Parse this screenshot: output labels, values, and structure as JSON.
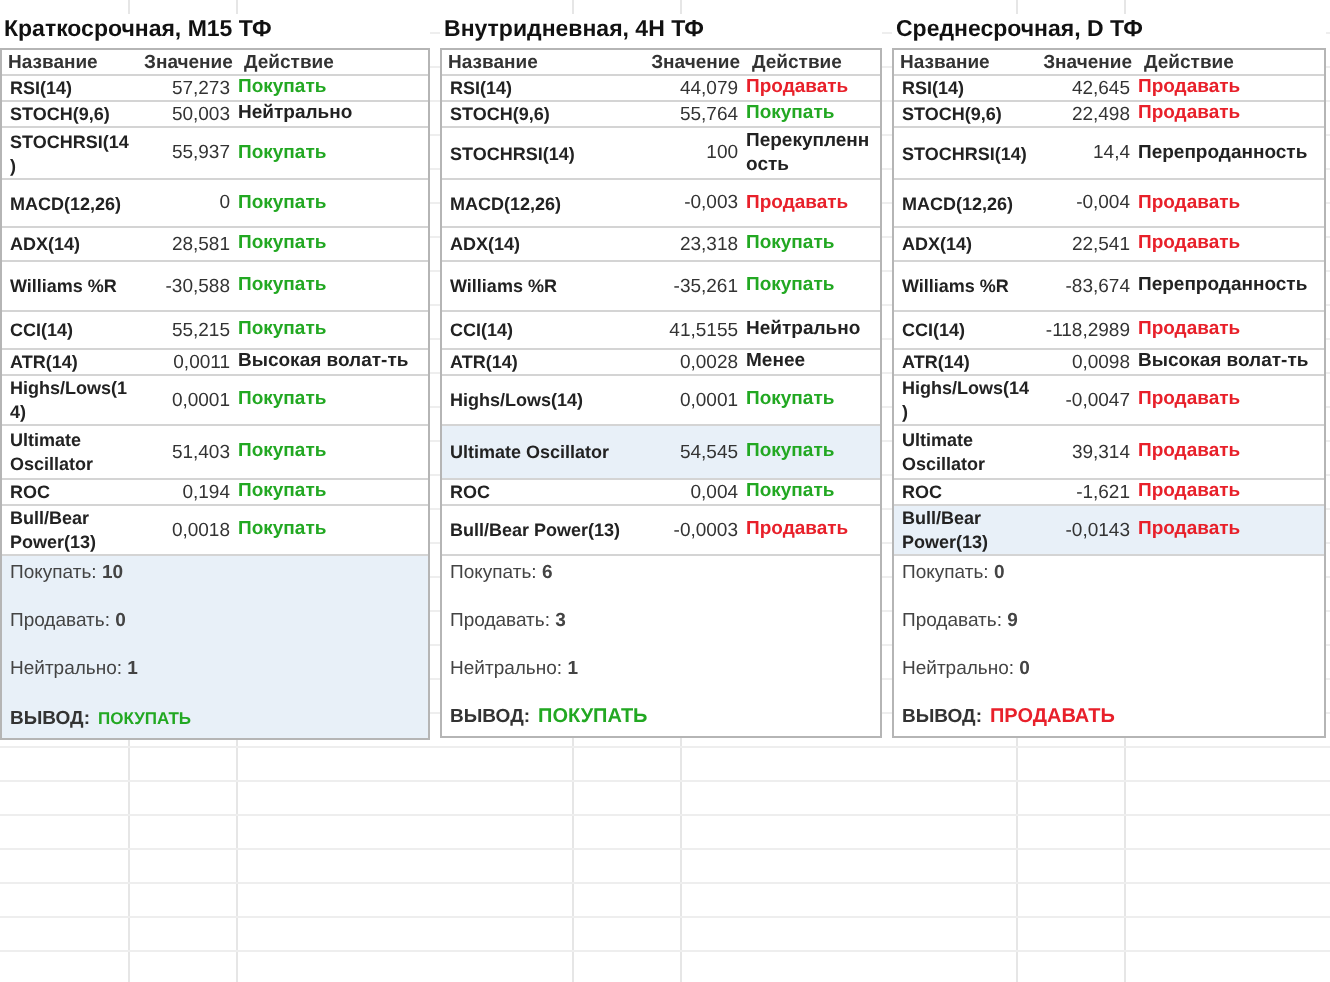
{
  "panels": [
    {
      "title": "Краткосрочная, M15 ТФ",
      "columns": [
        "Название",
        "Значение",
        "Действие"
      ],
      "rows": [
        {
          "name": "RSI(14)",
          "value": "57,273",
          "action": "Покупать",
          "color": "#22a822",
          "selected": false
        },
        {
          "name": "STOCH(9,6)",
          "value": "50,003",
          "action": "Нейтрально",
          "color": "#222222",
          "selected": false
        },
        {
          "name": "STOCHRSI(14)",
          "value": "55,937",
          "action": "Покупать",
          "color": "#22a822",
          "selected": false
        },
        {
          "name": "MACD(12,26)",
          "value": "0",
          "action": "Покупать",
          "color": "#22a822",
          "selected": false
        },
        {
          "name": "ADX(14)",
          "value": "28,581",
          "action": "Покупать",
          "color": "#22a822",
          "selected": false
        },
        {
          "name": "Williams %R",
          "value": "-30,588",
          "action": "Покупать",
          "color": "#22a822",
          "selected": false
        },
        {
          "name": "CCI(14)",
          "value": "55,215",
          "action": "Покупать",
          "color": "#22a822",
          "selected": false
        },
        {
          "name": "ATR(14)",
          "value": "0,0011",
          "action": "Высокая волат-ть",
          "color": "#222222",
          "selected": false
        },
        {
          "name": "Highs/Lows(14)",
          "value": "0,0001",
          "action": "Покупать",
          "color": "#22a822",
          "selected": false
        },
        {
          "name": "Ultimate Oscillator",
          "value": "51,403",
          "action": "Покупать",
          "color": "#22a822",
          "selected": false
        },
        {
          "name": "ROC",
          "value": "0,194",
          "action": "Покупать",
          "color": "#22a822",
          "selected": false
        },
        {
          "name": "Bull/Bear Power(13)",
          "value": "0,0018",
          "action": "Покупать",
          "color": "#22a822",
          "selected": false
        }
      ],
      "summary": {
        "selected": true,
        "lines": [
          "Покупать: **10**",
          "Продавать: **0**",
          "Нейтрально: **1**"
        ],
        "verdict_label": "ВЫВОД:",
        "verdict": "ПОКУПАТЬ",
        "color": "#22a822"
      }
    },
    {
      "title": "Внутридневная, 4H ТФ",
      "columns": [
        "Название",
        "Значение",
        "Действие"
      ],
      "rows": [
        {
          "name": "RSI(14)",
          "value": "44,079",
          "action": "Продавать",
          "color": "#e8202a",
          "selected": false
        },
        {
          "name": "STOCH(9,6)",
          "value": "55,764",
          "action": "Покупать",
          "color": "#22a822",
          "selected": false
        },
        {
          "name": "STOCHRSI(14)",
          "value": "100",
          "action": "Перекупленность",
          "color": "#222222",
          "selected": false
        },
        {
          "name": "MACD(12,26)",
          "value": "-0,003",
          "action": "Продавать",
          "color": "#e8202a",
          "selected": false
        },
        {
          "name": "ADX(14)",
          "value": "23,318",
          "action": "Покупать",
          "color": "#22a822",
          "selected": false
        },
        {
          "name": "Williams %R",
          "value": "-35,261",
          "action": "Покупать",
          "color": "#22a822",
          "selected": false
        },
        {
          "name": "CCI(14)",
          "value": "41,5155",
          "action": "Нейтрально",
          "color": "#222222",
          "selected": false
        },
        {
          "name": "ATR(14)",
          "value": "0,0028",
          "action": "Менее",
          "color": "#222222",
          "selected": false
        },
        {
          "name": "Highs/Lows(14)",
          "value": "0,0001",
          "action": "Покупать",
          "color": "#22a822",
          "selected": false
        },
        {
          "name": "Ultimate Oscillator",
          "value": "54,545",
          "action": "Покупать",
          "color": "#22a822",
          "selected": true
        },
        {
          "name": "ROC",
          "value": "0,004",
          "action": "Покупать",
          "color": "#22a822",
          "selected": false
        },
        {
          "name": "Bull/Bear Power(13)",
          "value": "-0,0003",
          "action": "Продавать",
          "color": "#e8202a",
          "selected": false
        }
      ],
      "summary": {
        "selected": false,
        "lines": [
          "Покупать: **6**",
          "Продавать: **3**",
          "Нейтрально: **1**"
        ],
        "verdict_label": "ВЫВОД:",
        "verdict": "ПОКУПАТЬ",
        "color": "#22a822"
      }
    },
    {
      "title": "Среднесрочная, D ТФ",
      "columns": [
        "Название",
        "Значение",
        "Действие"
      ],
      "rows": [
        {
          "name": "RSI(14)",
          "value": "42,645",
          "action": "Продавать",
          "color": "#e8202a",
          "selected": false
        },
        {
          "name": "STOCH(9,6)",
          "value": "22,498",
          "action": "Продавать",
          "color": "#e8202a",
          "selected": false
        },
        {
          "name": "STOCHRSI(14)",
          "value": "14,4",
          "action": "Перепроданность",
          "color": "#222222",
          "selected": false
        },
        {
          "name": "MACD(12,26)",
          "value": "-0,004",
          "action": "Продавать",
          "color": "#e8202a",
          "selected": false
        },
        {
          "name": "ADX(14)",
          "value": "22,541",
          "action": "Продавать",
          "color": "#e8202a",
          "selected": false
        },
        {
          "name": "Williams %R",
          "value": "-83,674",
          "action": "Перепроданность",
          "color": "#222222",
          "selected": false
        },
        {
          "name": "CCI(14)",
          "value": "-118,2989",
          "action": "Продавать",
          "color": "#e8202a",
          "selected": false
        },
        {
          "name": "ATR(14)",
          "value": "0,0098",
          "action": "Высокая волат-ть",
          "color": "#222222",
          "selected": false
        },
        {
          "name": "Highs/Lows(14)",
          "value": "-0,0047",
          "action": "Продавать",
          "color": "#e8202a",
          "selected": false
        },
        {
          "name": "Ultimate Oscillator",
          "value": "39,314",
          "action": "Продавать",
          "color": "#e8202a",
          "selected": false
        },
        {
          "name": "ROC",
          "value": "-1,621",
          "action": "Продавать",
          "color": "#e8202a",
          "selected": false
        },
        {
          "name": "Bull/Bear Power(13)",
          "value": "-0,0143",
          "action": "Продавать",
          "color": "#e8202a",
          "selected": true
        }
      ],
      "summary": {
        "selected": false,
        "lines": [
          "Покупать: **0**",
          "Продавать: **9**",
          "Нейтрально: **0**"
        ],
        "verdict_label": "ВЫВОД:",
        "verdict": "ПРОДАВАТЬ",
        "color": "#e8202a"
      }
    }
  ]
}
